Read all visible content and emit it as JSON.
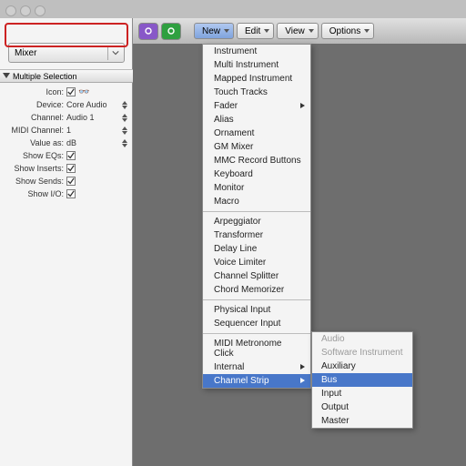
{
  "colors": {
    "accent": "#4877c9",
    "highlight_border": "#cc2222",
    "purple": "#8858c8",
    "green": "#2fa040"
  },
  "window": {
    "traffic_lights": 3
  },
  "sidebar": {
    "selector": {
      "value": "Mixer"
    },
    "section_title": "Multiple Selection",
    "params": [
      {
        "label": "Icon:",
        "type": "check_glasses",
        "checked": true
      },
      {
        "label": "Device:",
        "type": "spinner",
        "value": "Core Audio"
      },
      {
        "label": "Channel:",
        "type": "spinner",
        "value": "Audio 1"
      },
      {
        "label": "MIDI Channel:",
        "type": "spinner",
        "value": "1"
      },
      {
        "label": "Value as:",
        "type": "spinner",
        "value": "dB"
      },
      {
        "label": "Show EQs:",
        "type": "check",
        "checked": true
      },
      {
        "label": "Show Inserts:",
        "type": "check",
        "checked": true
      },
      {
        "label": "Show Sends:",
        "type": "check",
        "checked": true
      },
      {
        "label": "Show I/O:",
        "type": "check",
        "checked": true
      }
    ]
  },
  "toolbar": {
    "icon_buttons": [
      {
        "name": "link-icon",
        "color_key": "purple"
      },
      {
        "name": "cycle-icon",
        "color_key": "green"
      }
    ],
    "menus": [
      {
        "label": "New",
        "active": true
      },
      {
        "label": "Edit",
        "active": false
      },
      {
        "label": "View",
        "active": false
      },
      {
        "label": "Options",
        "active": false
      }
    ]
  },
  "dropdown": {
    "groups": [
      [
        {
          "label": "Instrument"
        },
        {
          "label": "Multi Instrument"
        },
        {
          "label": "Mapped Instrument"
        },
        {
          "label": "Touch Tracks"
        },
        {
          "label": "Fader",
          "submenu": true
        },
        {
          "label": "Alias"
        },
        {
          "label": "Ornament"
        },
        {
          "label": "GM Mixer"
        },
        {
          "label": "MMC Record Buttons"
        },
        {
          "label": "Keyboard"
        },
        {
          "label": "Monitor"
        },
        {
          "label": "Macro"
        }
      ],
      [
        {
          "label": "Arpeggiator"
        },
        {
          "label": "Transformer"
        },
        {
          "label": "Delay Line"
        },
        {
          "label": "Voice Limiter"
        },
        {
          "label": "Channel Splitter"
        },
        {
          "label": "Chord Memorizer"
        }
      ],
      [
        {
          "label": "Physical Input"
        },
        {
          "label": "Sequencer Input"
        }
      ],
      [
        {
          "label": "MIDI Metronome Click"
        },
        {
          "label": "Internal",
          "submenu": true
        },
        {
          "label": "Channel Strip",
          "submenu": true,
          "highlight": true
        }
      ]
    ]
  },
  "submenu": {
    "items": [
      {
        "label": "Audio",
        "dim": true
      },
      {
        "label": "Software Instrument",
        "dim": true
      },
      {
        "label": "Auxiliary"
      },
      {
        "label": "Bus",
        "highlight": true
      },
      {
        "label": "Input"
      },
      {
        "label": "Output"
      },
      {
        "label": "Master"
      }
    ]
  }
}
